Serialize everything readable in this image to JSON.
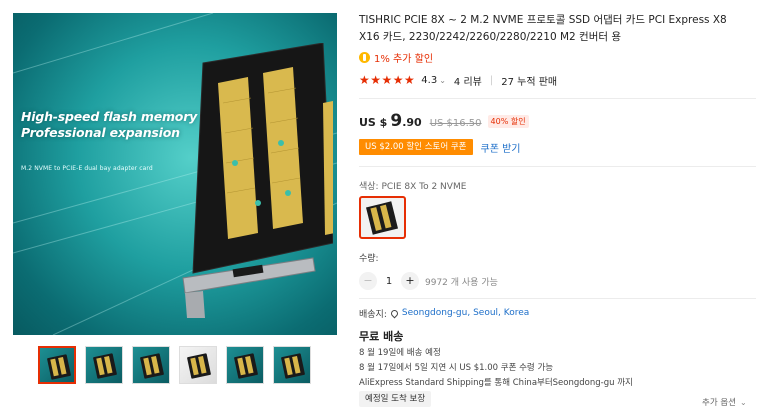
{
  "gallery": {
    "headline": [
      "High-speed flash memory",
      "Professional expansion"
    ],
    "subline": "M.2 NVME to PCIE-E dual bay adapter card",
    "thumbnails": [
      {
        "name": "thumb-1",
        "active": true
      },
      {
        "name": "thumb-2",
        "active": false
      },
      {
        "name": "thumb-3",
        "active": false
      },
      {
        "name": "thumb-4",
        "active": false
      },
      {
        "name": "thumb-5",
        "active": false
      },
      {
        "name": "thumb-6",
        "active": false
      }
    ]
  },
  "product": {
    "title": "TISHRIC PCIE 8X ~ 2 M.2 NVME 프로토콜 SSD 어댑터 카드 PCI Express X8 X16 카드, 2230/2242/2260/2280/2210 M2 컨버터 용",
    "extra_discount": "1% 추가 할인",
    "stars": "★★★★★",
    "rating": "4.3",
    "rating_chevron": "⌄",
    "reviews": "4 리뷰",
    "separator": "|",
    "sold": "27 누적 판매"
  },
  "price": {
    "currency": "US $",
    "integer": "9",
    "decimal": ".90",
    "original": "US $16.50",
    "discount": "40% 할인"
  },
  "coupon": {
    "tag": "US $2.00 할인 스토어 쿠폰",
    "action": "쿠폰 받기"
  },
  "color": {
    "label": "색상: ",
    "value": "PCIE 8X To 2 NVME"
  },
  "quantity": {
    "label": "수량:",
    "minus": "−",
    "value": "1",
    "plus": "+",
    "available": "9972 개 사용 가능"
  },
  "shipping": {
    "label": "배송지:",
    "location": "Seongdong-gu, Seoul, Korea",
    "free": "무료 배송",
    "delivery": "8 월 19일에 배송 예정",
    "late_coupon": "8 월 17일에서 5일 지연 시 US $1.00 쿠폰 수령 가능",
    "method": "AliExpress Standard Shipping를 통해 China부터Seongdong-gu 까지",
    "guarantee": "예정일 도착 보장",
    "more_options": "추가 옵션",
    "more_chevron": "⌄"
  },
  "colors": {
    "accent": "#e62e04",
    "coupon": "#ff8c00",
    "link": "#1e6fc9",
    "coin": "#ffb800"
  }
}
